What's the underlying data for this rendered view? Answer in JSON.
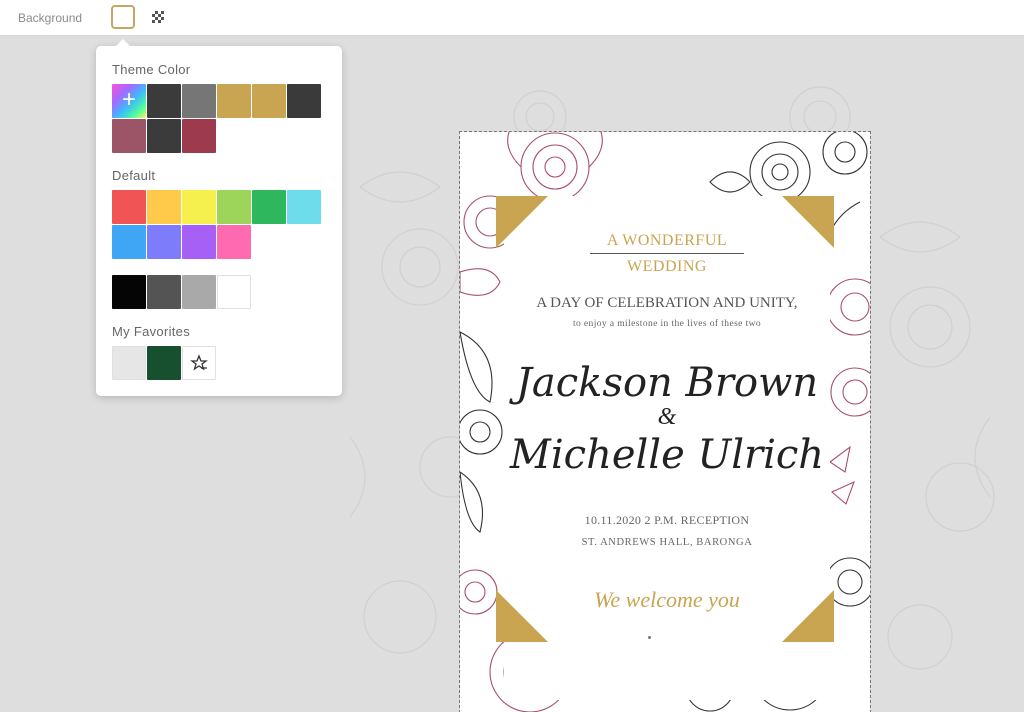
{
  "toolbar": {
    "background_label": "Background",
    "current_color": "#ffffff",
    "transparent_icon": "transparent-checker-icon"
  },
  "picker": {
    "theme_title": "Theme Color",
    "theme_colors": [
      "add",
      "#3b3b3b",
      "#767676",
      "#c9a552",
      "#c9a552",
      "#3a3a3a",
      "#9b5567",
      "#3b3b3b",
      "#9e3a4e"
    ],
    "default_title": "Default",
    "default_colors": [
      "#f05454",
      "#ffc94a",
      "#f5f04e",
      "#9dd45a",
      "#2fb75e",
      "#6fdcec",
      "#3ea6f5",
      "#7d7dfc",
      "#a660f5",
      "#ff6ab0"
    ],
    "gray_colors": [
      "#050505",
      "#545454",
      "#a9a9a9",
      "#ffffff"
    ],
    "favorites_title": "My Favorites",
    "favorite_colors": [
      "#e6e6e6",
      "#16502e"
    ],
    "add_favorite_icon": "star-add-icon"
  },
  "card": {
    "headline_1": "A WONDERFUL",
    "headline_2": "WEDDING",
    "subtitle": "A DAY OF CELEBRATION AND UNITY,",
    "subtext": "to enjoy a milestone in the lives of these two",
    "name_1": "Jackson Brown",
    "ampersand": "&",
    "name_2": "Michelle Ulrich",
    "date_line": "10.11.2020   2 P.M. RECEPTION",
    "venue": "ST. ANDREWS HALL, BARONGA",
    "welcome": "We welcome you",
    "accent_color": "#c9a552",
    "floral_pink": "#a8506a",
    "floral_dark": "#333333"
  }
}
